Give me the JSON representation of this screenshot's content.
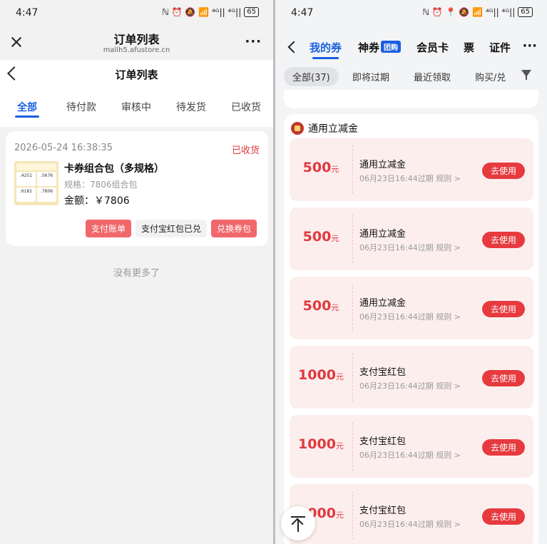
{
  "left": {
    "status": {
      "time": "4:47",
      "icons": "ℕ ⏰ 🔕 📶 ⁴ᴳ|| ⁴ᴳ||",
      "battery": "65"
    },
    "browser": {
      "title": "订单列表",
      "url": "mallh5.afustore.cn",
      "more": "···"
    },
    "page": {
      "title": "订单列表"
    },
    "tabs": [
      "全部",
      "待付款",
      "审核中",
      "待发货",
      "已收货"
    ],
    "order": {
      "date": "2026-05-24 16:38:35",
      "status": "已收货",
      "thumb_values": [
        ".4251",
        ".5676",
        ".6181",
        ".7806"
      ],
      "name": "卡券组合包（多规格）",
      "spec": "规格：7806组合包",
      "amount": "金额：￥7806",
      "buttons": [
        "支付账单",
        "支付宝红包已兑",
        "兑换券包"
      ]
    },
    "no_more": "没有更多了"
  },
  "right": {
    "status": {
      "time": "4:47",
      "icons": "ℕ ⏰ 📍 🔕 📶 ⁴ᴳ|| ⁴ᴳ||",
      "battery": "65"
    },
    "tabs": {
      "my": "我的券",
      "shen": "神券",
      "tuan": "团购",
      "member": "会员卡",
      "ticket": "票",
      "cert": "证件",
      "more": "···"
    },
    "filters": [
      "全部(37)",
      "即将过期",
      "最近领取",
      "购买/兑"
    ],
    "group_title": "通用立减金",
    "coupons": [
      {
        "amount": "500",
        "unit": "元",
        "name": "通用立减金",
        "expiry": "06月23日16:44过期  规则 >",
        "action": "去使用"
      },
      {
        "amount": "500",
        "unit": "元",
        "name": "通用立减金",
        "expiry": "06月23日16:44过期  规则 >",
        "action": "去使用"
      },
      {
        "amount": "500",
        "unit": "元",
        "name": "通用立减金",
        "expiry": "06月23日16:44过期  规则 >",
        "action": "去使用"
      },
      {
        "amount": "1000",
        "unit": "元",
        "name": "支付宝红包",
        "expiry": "06月23日16:44过期  规则 >",
        "action": "去使用"
      },
      {
        "amount": "1000",
        "unit": "元",
        "name": "支付宝红包",
        "expiry": "06月23日16:44过期  规则 >",
        "action": "去使用"
      },
      {
        "amount": "1000",
        "unit": "元",
        "name": "支付宝红包",
        "expiry": "06月23日16:44过期  规则 >",
        "action": "去使用"
      }
    ]
  },
  "colors": {
    "accent": "#1a5fe0",
    "red": "#e0393e",
    "coupon_bg": "#fdeeee"
  }
}
